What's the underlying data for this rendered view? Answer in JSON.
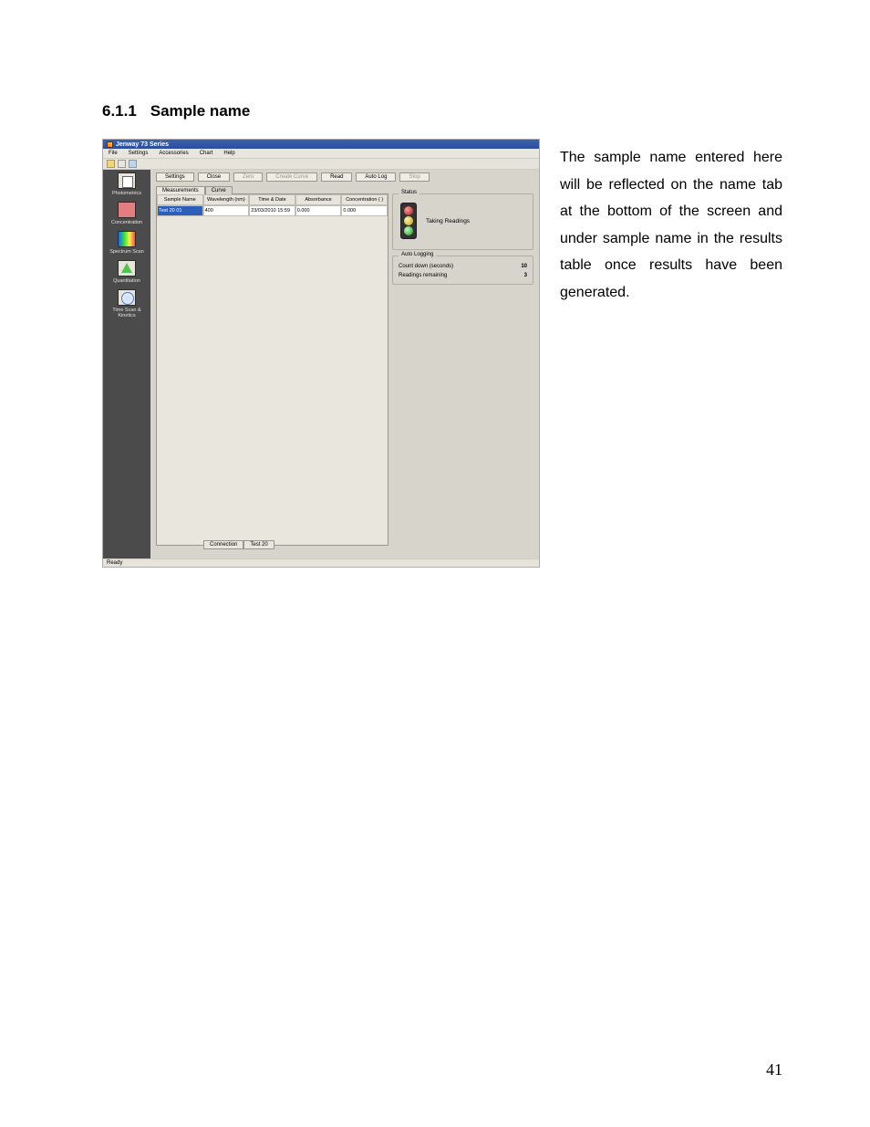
{
  "heading": {
    "number": "6.1.1",
    "title": "Sample name"
  },
  "paragraph": "The sample name entered here will be reflected on the name tab at the bottom of the screen and under sample name in the results table once results have been generated.",
  "page_number": "41",
  "app": {
    "title": "Jenway 73 Series",
    "menu": [
      "File",
      "Settings",
      "Accessories",
      "Chart",
      "Help"
    ],
    "sidebar": [
      {
        "label": "Photometrics",
        "kind": "photometrics"
      },
      {
        "label": "Concentration",
        "kind": "concentration"
      },
      {
        "label": "Spectrum Scan",
        "kind": "spectrum"
      },
      {
        "label": "Quantitation",
        "kind": "quant"
      },
      {
        "label": "Time Scan & Kinetics",
        "kind": "timescan"
      }
    ],
    "buttons": {
      "settings": "Settings",
      "close": "Close",
      "zero": "Zero",
      "create_curve": "Create Curve",
      "read": "Read",
      "auto_log": "Auto Log",
      "stop": "Stop"
    },
    "tabs": {
      "measurements": "Measurements",
      "curve": "Curve"
    },
    "table": {
      "headers": [
        "Sample Name",
        "Wavelength (nm)",
        "Time & Date",
        "Absorbance",
        "Concentration ( )"
      ],
      "row": {
        "sample_name": "Test 20 01",
        "wavelength": "400",
        "time_date": "23/03/2010 15:59",
        "absorbance": "0.000",
        "concentration": "0.000"
      }
    },
    "status": {
      "group_title": "Status",
      "text": "Taking Readings"
    },
    "autolog": {
      "group_title": "Auto Logging",
      "countdown_label": "Count down (seconds)",
      "countdown_value": "10",
      "remaining_label": "Readings remaining",
      "remaining_value": "3"
    },
    "footer_tabs": {
      "connection": "Connection",
      "test": "Test 20"
    },
    "status_strip": "Ready"
  }
}
